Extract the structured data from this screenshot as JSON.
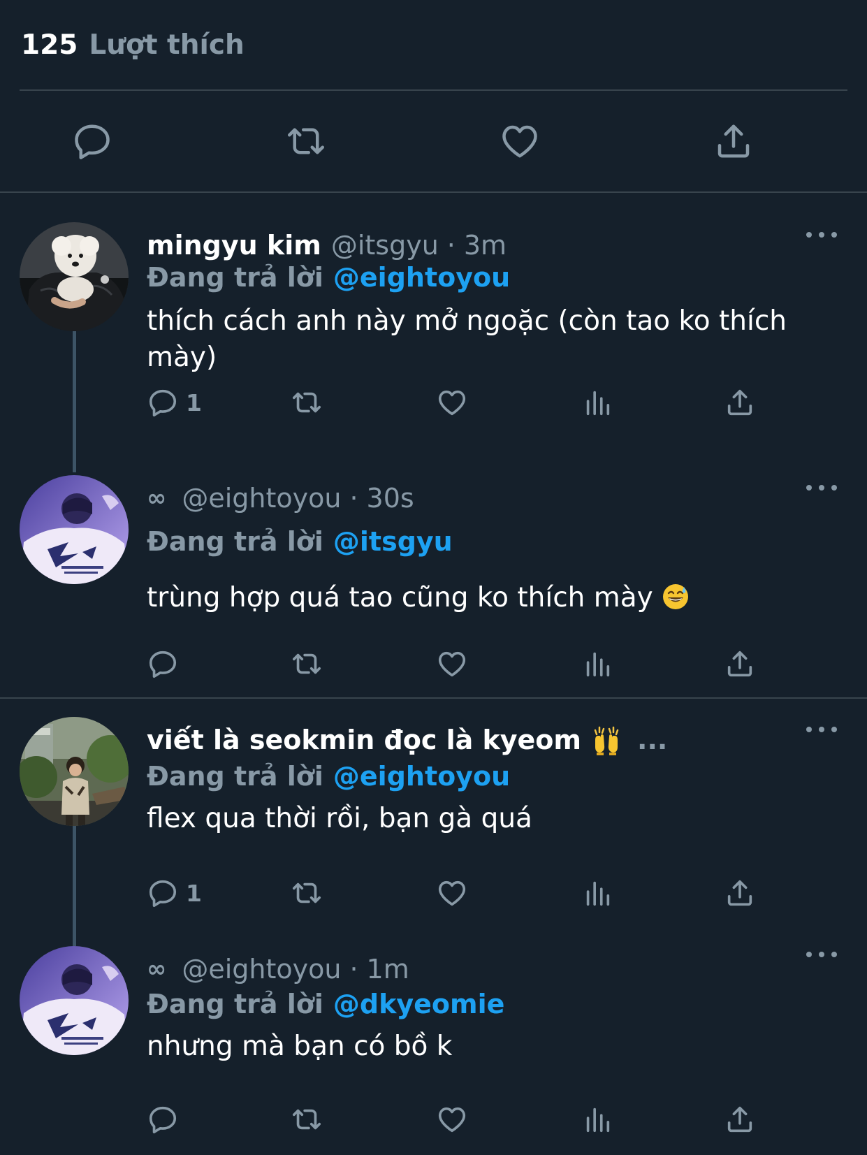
{
  "likes": {
    "count": "125",
    "label": "Lượt thích"
  },
  "colors": {
    "background": "#15202b",
    "muted": "#8899a6",
    "link": "#1da1f2",
    "divider": "#38444d"
  },
  "main_actions": [
    "reply-icon",
    "retweet-icon",
    "like-icon",
    "share-icon"
  ],
  "thread1": {
    "tweet1": {
      "name": "mingyu kim",
      "handle": "@itsgyu",
      "time": "3m",
      "reply_label": "Đang trả lời",
      "reply_to": "@eightoyou",
      "text": "thích cách anh này mở ngoặc (còn tao ko thích mày)",
      "reply_count": "1"
    },
    "tweet2": {
      "name_symbol": "∞",
      "handle": "@eightoyou",
      "time": "30s",
      "reply_label": "Đang trả lời",
      "reply_to": "@itsgyu",
      "text": "trùng hợp quá tao cũng ko thích mày"
    }
  },
  "thread2": {
    "tweet1": {
      "name": "viết là seokmin đọc là kyeom",
      "name_overflow": "...",
      "reply_label": "Đang trả lời",
      "reply_to": "@eightoyou",
      "text": "flex qua thời rồi, bạn gà quá",
      "reply_count": "1"
    },
    "tweet2": {
      "name_symbol": "∞",
      "handle": "@eightoyou",
      "time": "1m",
      "reply_label": "Đang trả lời",
      "reply_to": "@dkyeomie",
      "text": "nhưng mà bạn có bồ k"
    }
  }
}
